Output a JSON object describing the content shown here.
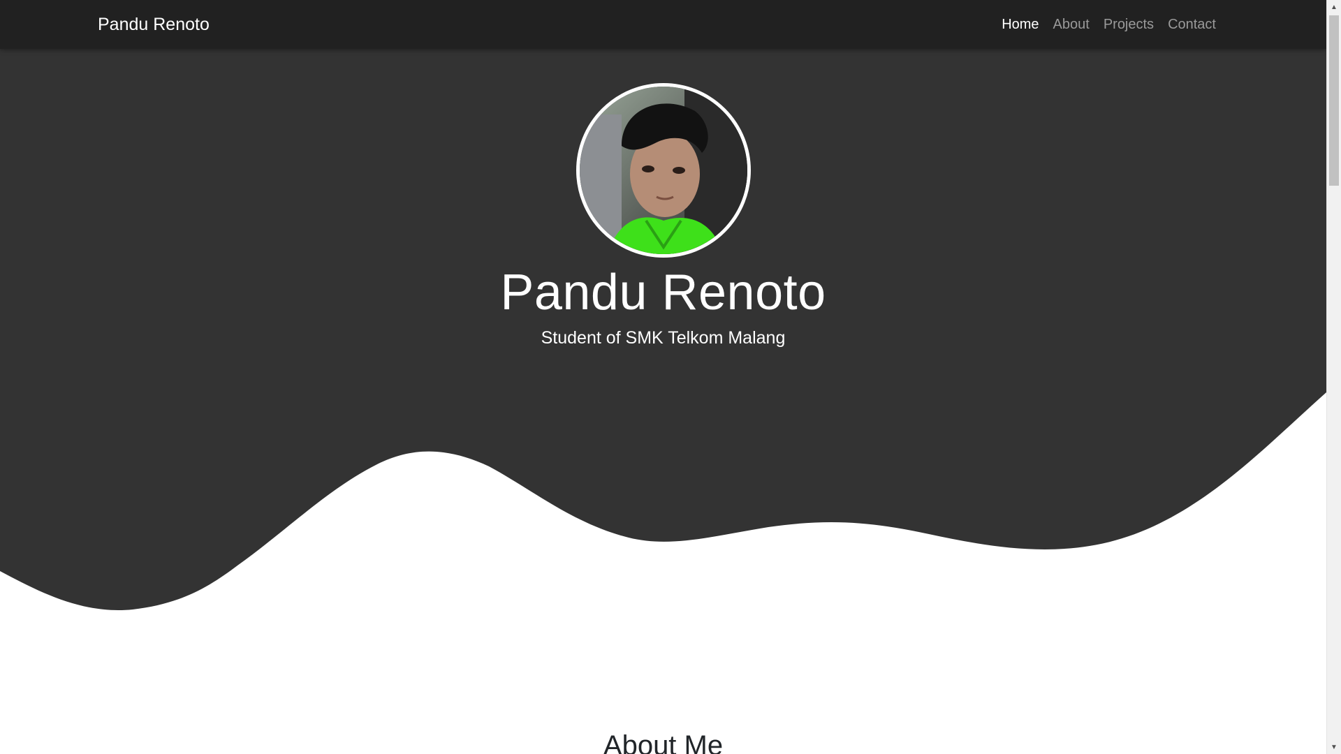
{
  "navbar": {
    "brand": "Pandu Renoto",
    "links": [
      {
        "label": "Home",
        "active": true
      },
      {
        "label": "About",
        "active": false
      },
      {
        "label": "Projects",
        "active": false
      },
      {
        "label": "Contact",
        "active": false
      }
    ]
  },
  "hero": {
    "title": "Pandu Renoto",
    "subtitle": "Student of SMK Telkom Malang",
    "background_color": "#333333",
    "avatar_icon": "profile-photo"
  },
  "about": {
    "heading": "About Me"
  },
  "colors": {
    "navbar_bg": "#212121",
    "hero_bg": "#333333",
    "nav_inactive": "#9a9a9a",
    "nav_active": "#ffffff"
  }
}
